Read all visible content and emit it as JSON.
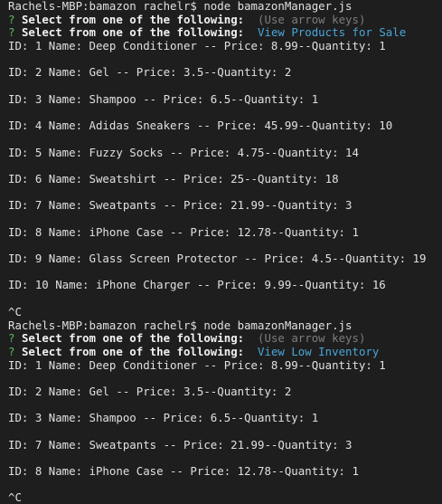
{
  "colors": {
    "background": "#1e1e1e",
    "text": "#e0e0e0",
    "prompt_mark": "#5bb85b",
    "hint": "#7d7d7d",
    "answer": "#4aa6d8"
  },
  "session1": {
    "command": "Rachels-MBP:bamazon rachelr$ node bamazonManager.js",
    "mark": "?",
    "question": "Select from one of the following:",
    "hint": "(Use arrow keys)",
    "answer": "View Products for Sale",
    "rows": [
      "ID: 1 Name: Deep Conditioner -- Price: 8.99--Quantity: 1",
      "ID: 2 Name: Gel -- Price: 3.5--Quantity: 2",
      "ID: 3 Name: Shampoo -- Price: 6.5--Quantity: 1",
      "ID: 4 Name: Adidas Sneakers -- Price: 45.99--Quantity: 10",
      "ID: 5 Name: Fuzzy Socks -- Price: 4.75--Quantity: 14",
      "ID: 6 Name: Sweatshirt -- Price: 25--Quantity: 18",
      "ID: 7 Name: Sweatpants -- Price: 21.99--Quantity: 3",
      "ID: 8 Name: iPhone Case -- Price: 12.78--Quantity: 1",
      "ID: 9 Name: Glass Screen Protector -- Price: 4.5--Quantity: 19",
      "ID: 10 Name: iPhone Charger -- Price: 9.99--Quantity: 16"
    ],
    "interrupt": "^C"
  },
  "session2": {
    "command": "Rachels-MBP:bamazon rachelr$ node bamazonManager.js",
    "mark": "?",
    "question": "Select from one of the following:",
    "hint": "(Use arrow keys)",
    "answer": "View Low Inventory",
    "rows": [
      "ID: 1 Name: Deep Conditioner -- Price: 8.99--Quantity: 1",
      "ID: 2 Name: Gel -- Price: 3.5--Quantity: 2",
      "ID: 3 Name: Shampoo -- Price: 6.5--Quantity: 1",
      "ID: 7 Name: Sweatpants -- Price: 21.99--Quantity: 3",
      "ID: 8 Name: iPhone Case -- Price: 12.78--Quantity: 1"
    ],
    "interrupt": "^C"
  }
}
